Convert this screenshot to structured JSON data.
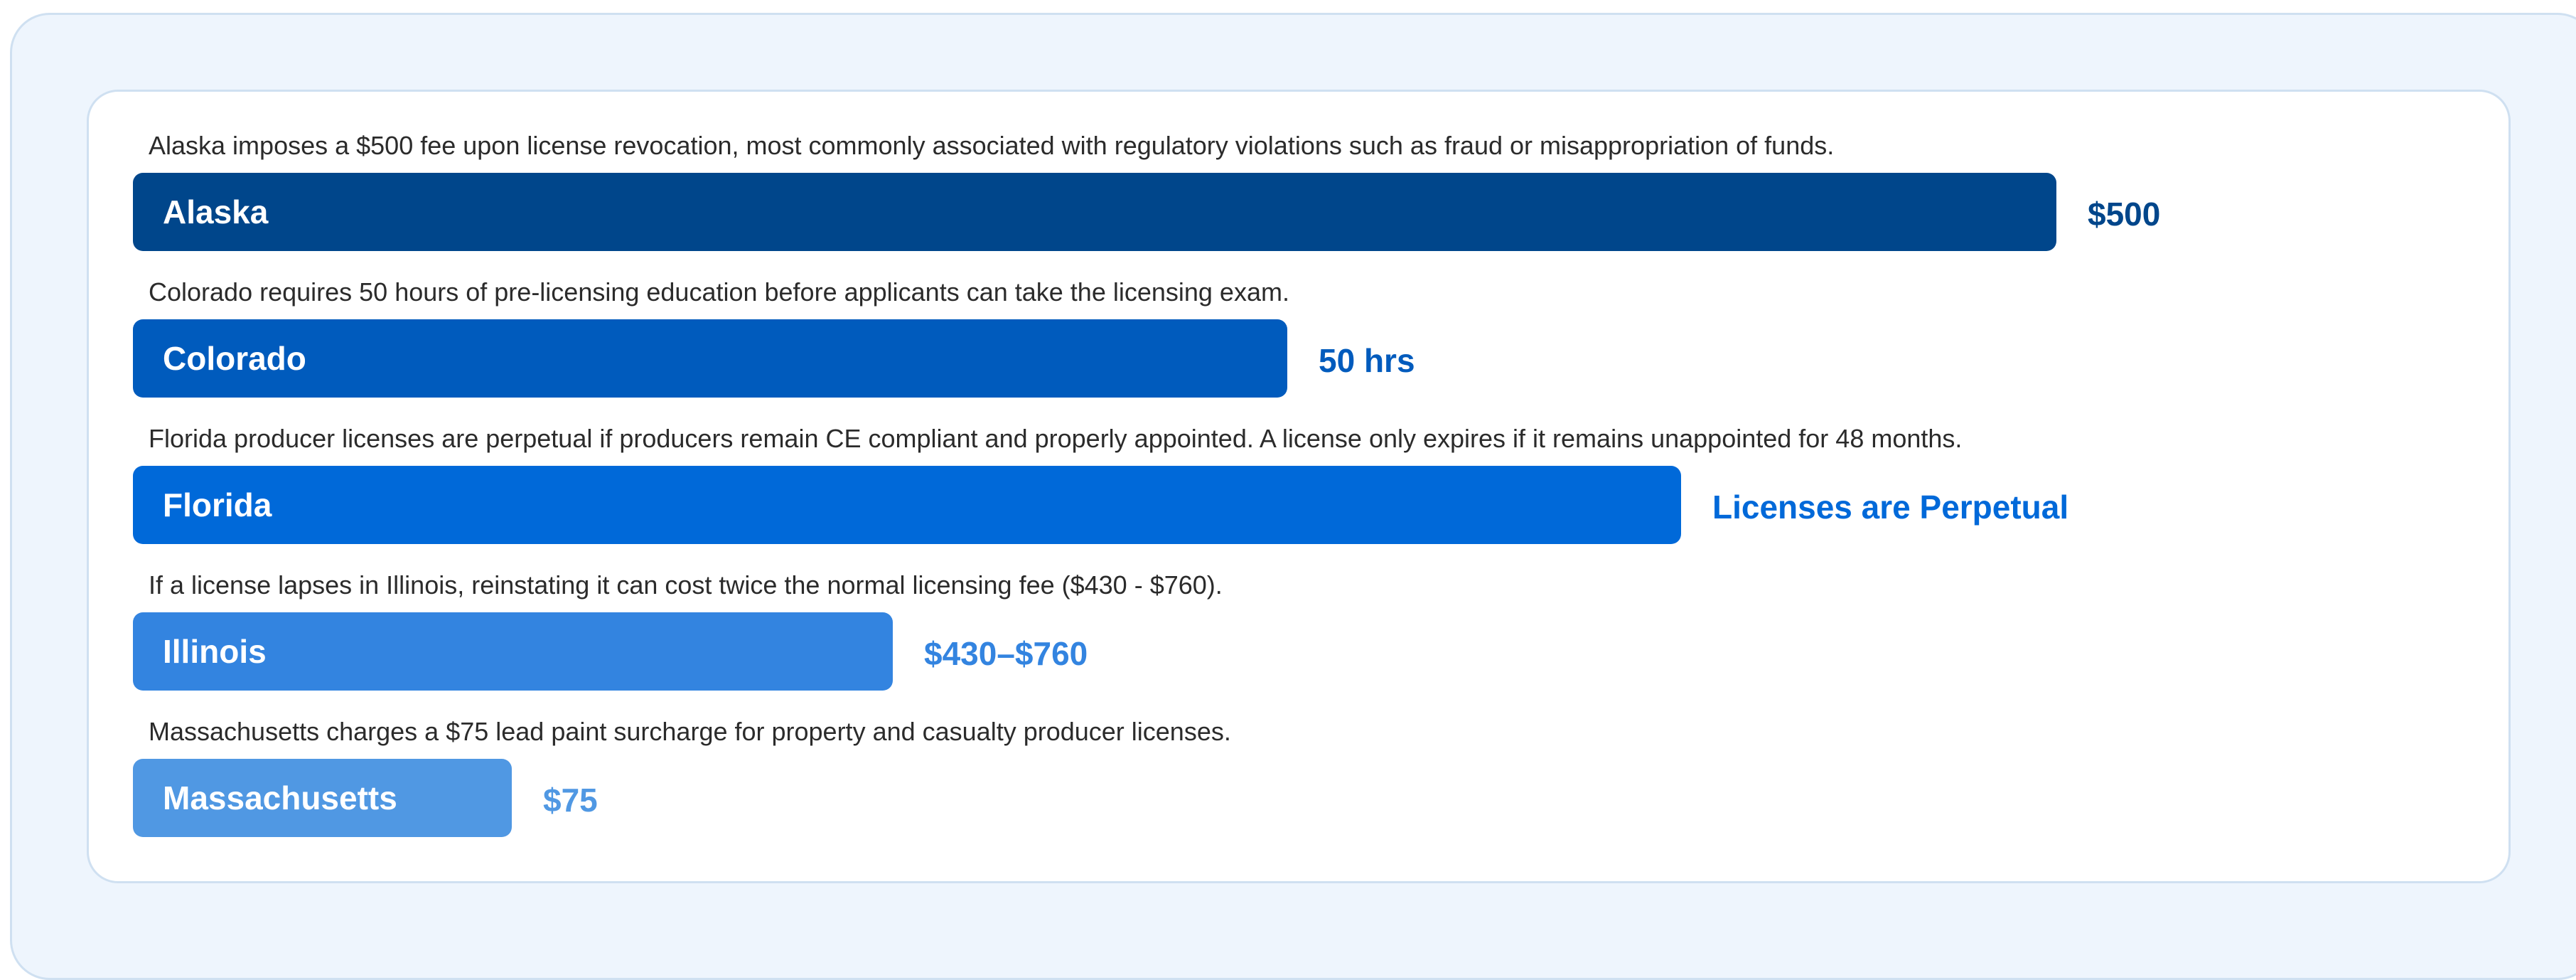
{
  "chart_data": {
    "type": "bar",
    "orientation": "horizontal",
    "legend": "none",
    "grid": false,
    "categories": [
      "Alaska",
      "Colorado",
      "Florida",
      "Illinois",
      "Massachusetts"
    ],
    "values": [
      100,
      60,
      80.5,
      39.5,
      19.7
    ],
    "value_labels": [
      "$500",
      "50 hrs",
      "Licenses are Perpetual",
      "$430–$760",
      "$75"
    ],
    "descriptions": [
      "Alaska imposes a $500 fee upon license revocation, most commonly associated with regulatory violations such as fraud or misappropriation of funds.",
      "Colorado requires 50 hours of pre-licensing education before applicants can take the licensing exam.",
      "Florida producer licenses are perpetual if producers remain CE compliant and properly appointed. A license only expires if it remains unappointed for 48 months.",
      "If a license lapses in Illinois, reinstating it can cost twice the normal licensing fee ($430 - $760).",
      "Massachusetts charges a $75 lead paint surcharge for property and casualty producer licenses."
    ],
    "colors": [
      "#00468b",
      "#005bbd",
      "#0069d9",
      "#3384e0",
      "#5098e3"
    ],
    "xlim": [
      0,
      100
    ]
  }
}
